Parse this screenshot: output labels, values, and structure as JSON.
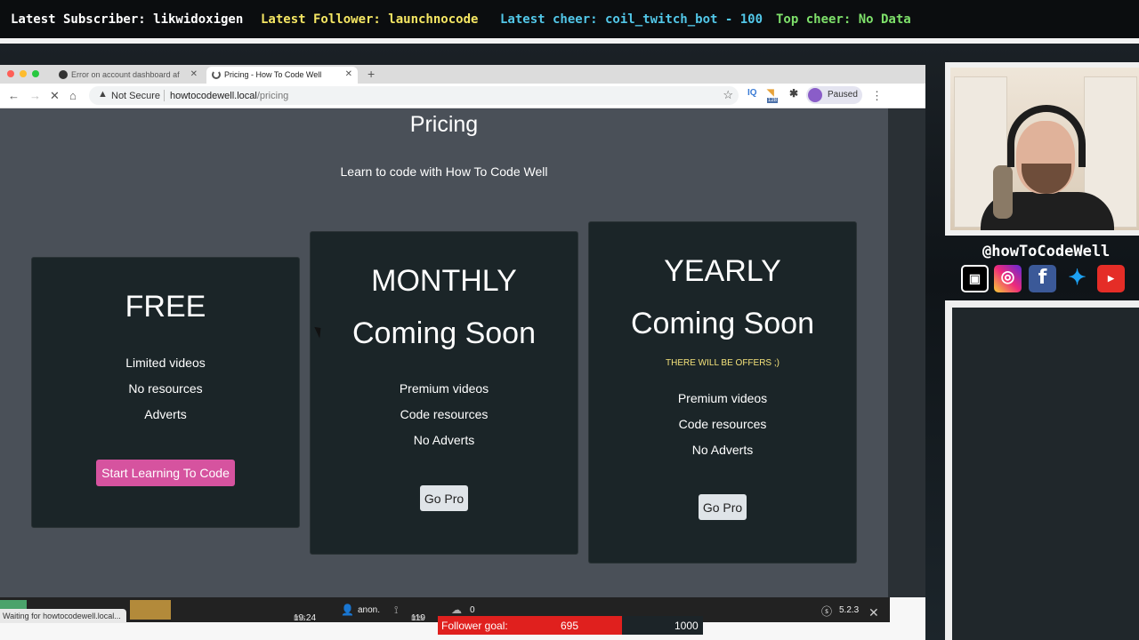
{
  "stream_overlay": {
    "latest_subscriber": "Latest Subscriber: likwidoxigen",
    "latest_follower": "Latest Follower: launchnocode",
    "latest_cheer": "Latest cheer: coil_twitch_bot - 100",
    "top_cheer": "Top cheer: No Data",
    "colors": {
      "subscriber": "#ffffff",
      "follower": "#f5e663",
      "cheer": "#52c7e8",
      "top_cheer": "#7ee06a"
    }
  },
  "browser": {
    "tabs": [
      {
        "label": "Error on account dashboard af",
        "icon": "github-icon",
        "active": false
      },
      {
        "label": "Pricing - How To Code Well",
        "icon": "loading-icon",
        "active": true
      }
    ],
    "address": {
      "security": "Not Secure",
      "host": "howtocodewell.local",
      "path": "/pricing"
    },
    "profile_status": "Paused",
    "extension_badge": "128",
    "status_bubble": "Waiting for howtocodewell.local..."
  },
  "page": {
    "title": "Pricing",
    "subtitle": "Learn to code with How To Code Well",
    "plans": [
      {
        "name": "FREE",
        "coming_soon": "",
        "note": "",
        "features": [
          "Limited videos",
          "No resources",
          "Adverts"
        ],
        "button": "Start Learning To Code"
      },
      {
        "name": "MONTHLY",
        "coming_soon": "Coming Soon",
        "note": "",
        "features": [
          "Premium videos",
          "Code resources",
          "No Adverts"
        ],
        "button": "Go Pro"
      },
      {
        "name": "YEARLY",
        "coming_soon": "Coming Soon",
        "note": "THERE WILL BE OFFERS ;)",
        "features": [
          "Premium videos",
          "Code resources",
          "No Adverts"
        ],
        "button": "Go Pro"
      }
    ]
  },
  "debug_toolbar": {
    "time": "19.24",
    "time_unit": "ms",
    "user": "anon.",
    "twig_time": "119",
    "twig_unit": "ms",
    "cache_count": "0",
    "version": "5.2.3"
  },
  "webcam": {
    "handle": "@howToCodeWell",
    "socials": [
      "twitch-icon",
      "instagram-icon",
      "facebook-icon",
      "twitter-icon",
      "youtube-icon"
    ]
  },
  "follower_goal": {
    "label": "Follower goal:",
    "current": "695",
    "target": "1000",
    "progress": 0.695
  }
}
